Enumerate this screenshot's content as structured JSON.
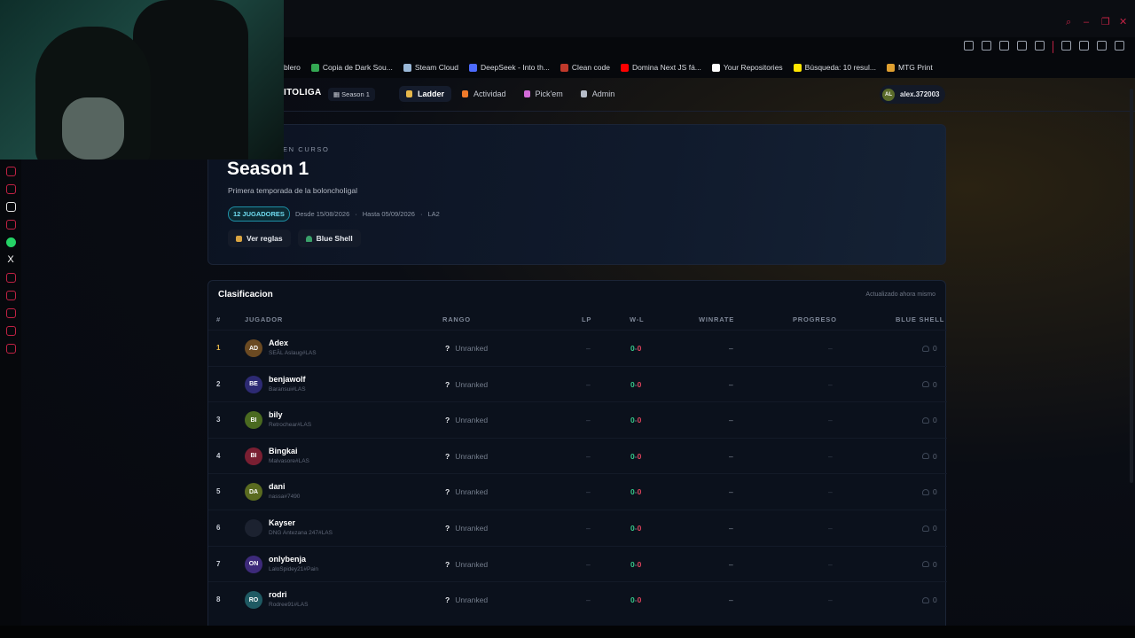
{
  "browser": {
    "bookmarks": [
      {
        "label": "blero",
        "color": "#999999"
      },
      {
        "label": "Copia de Dark Sou...",
        "color": "#34a853"
      },
      {
        "label": "Steam Cloud",
        "color": "#9ab8d8"
      },
      {
        "label": "DeepSeek - Into th...",
        "color": "#4d6bfe"
      },
      {
        "label": "Clean code",
        "color": "#c0392b"
      },
      {
        "label": "Domina Next JS fá...",
        "color": "#ff0000"
      },
      {
        "label": "Your Repositories",
        "color": "#ffffff"
      },
      {
        "label": "Búsqueda: 10 resul...",
        "color": "#ffe600"
      },
      {
        "label": "MTG Print",
        "color": "#e0a030"
      }
    ]
  },
  "nav": {
    "brand": "ITOLIGA",
    "season_pill": "Season 1",
    "links": [
      {
        "label": "Ladder",
        "active": true,
        "icon": "trophy-icon",
        "color": "#e7b84b"
      },
      {
        "label": "Actividad",
        "active": false,
        "icon": "fire-icon",
        "color": "#f07a2a"
      },
      {
        "label": "Pick'em",
        "active": false,
        "icon": "target-icon",
        "color": "#d26ad8"
      },
      {
        "label": "Admin",
        "active": false,
        "icon": "gear-icon",
        "color": "#b6bcc8"
      }
    ],
    "user": {
      "initials": "AL",
      "name": "alex.372003"
    }
  },
  "hero": {
    "eyebrow": "EN CURSO",
    "title": "Season 1",
    "subtitle": "Primera temporada de la bolonchoIigal",
    "badge": "12 JUGADORES",
    "from": "Desde 15/08/2026",
    "to": "Hasta 05/09/2026",
    "region": "LA2",
    "rules_button": "Ver reglas",
    "blue_shell_button": "Blue Shell"
  },
  "board": {
    "title": "Clasificacion",
    "updated": "Actualizado ahora mismo",
    "columns": {
      "rank": "#",
      "player": "JUGADOR",
      "tier": "RANGO",
      "lp": "LP",
      "wl": "W-L",
      "winrate": "WINRATE",
      "progress": "PROGRESO",
      "blue_shell": "BLUE SHELL"
    },
    "rows": [
      {
        "pos": "1",
        "initials": "AD",
        "name": "Adex",
        "tag": "SEÃL Aslaug#LAS",
        "avatar_color": "#6b4a22",
        "tier": "Unranked",
        "lp": "–",
        "wins": "0",
        "losses": "0",
        "winrate": "–",
        "progress": "–",
        "shells": "0"
      },
      {
        "pos": "2",
        "initials": "BE",
        "name": "benjawolf",
        "tag": "Baransui#LAS",
        "avatar_color": "#2d2a73",
        "tier": "Unranked",
        "lp": "–",
        "wins": "0",
        "losses": "0",
        "winrate": "–",
        "progress": "–",
        "shells": "0"
      },
      {
        "pos": "3",
        "initials": "BI",
        "name": "bily",
        "tag": "Retrochear#LAS",
        "avatar_color": "#4a6a20",
        "tier": "Unranked",
        "lp": "–",
        "wins": "0",
        "losses": "0",
        "winrate": "–",
        "progress": "–",
        "shells": "0"
      },
      {
        "pos": "4",
        "initials": "BI",
        "name": "Bingkai",
        "tag": "Malvasore#LAS",
        "avatar_color": "#7a1f32",
        "tier": "Unranked",
        "lp": "–",
        "wins": "0",
        "losses": "0",
        "winrate": "–",
        "progress": "–",
        "shells": "0"
      },
      {
        "pos": "5",
        "initials": "DA",
        "name": "dani",
        "tag": "nassa#7490",
        "avatar_color": "#5a6b20",
        "tier": "Unranked",
        "lp": "–",
        "wins": "0",
        "losses": "0",
        "winrate": "–",
        "progress": "–",
        "shells": "0"
      },
      {
        "pos": "6",
        "initials": "",
        "name": "Kayser",
        "tag": "DNG Antezana 247#LAS",
        "avatar_color": "#1c2230",
        "tier": "Unranked",
        "lp": "–",
        "wins": "0",
        "losses": "0",
        "winrate": "–",
        "progress": "–",
        "shells": "0"
      },
      {
        "pos": "7",
        "initials": "ON",
        "name": "onlybenja",
        "tag": "LaloSpidey21#Pain",
        "avatar_color": "#3d2a7a",
        "tier": "Unranked",
        "lp": "–",
        "wins": "0",
        "losses": "0",
        "winrate": "–",
        "progress": "–",
        "shells": "0"
      },
      {
        "pos": "8",
        "initials": "RO",
        "name": "rodri",
        "tag": "Rodree91#LAS",
        "avatar_color": "#1f5a63",
        "tier": "Unranked",
        "lp": "–",
        "wins": "0",
        "losses": "0",
        "winrate": "–",
        "progress": "–",
        "shells": "0"
      }
    ]
  }
}
